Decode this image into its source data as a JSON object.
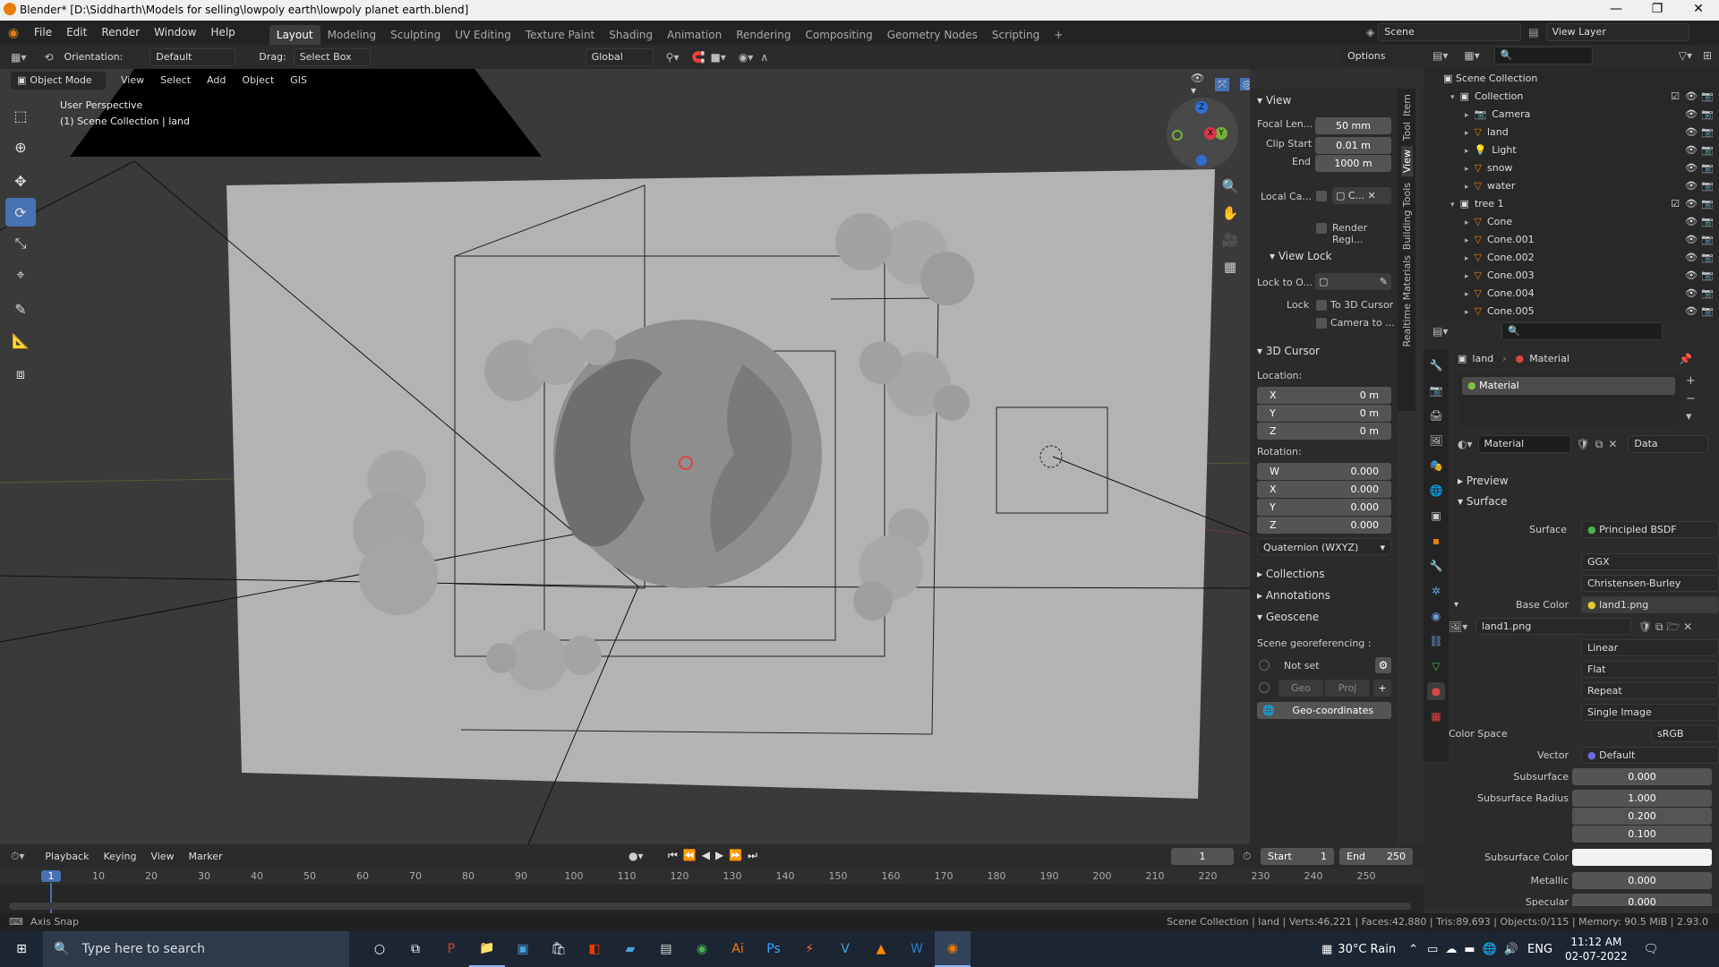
{
  "window": {
    "title": "Blender* [D:\\Siddharth\\Models for selling\\lowpoly earth\\lowpoly planet earth.blend]",
    "min": "—",
    "max": "❐",
    "close": "✕"
  },
  "menu": [
    "File",
    "Edit",
    "Render",
    "Window",
    "Help"
  ],
  "workspaces": [
    "Layout",
    "Modeling",
    "Sculpting",
    "UV Editing",
    "Texture Paint",
    "Shading",
    "Animation",
    "Rendering",
    "Compositing",
    "Geometry Nodes",
    "Scripting",
    "+"
  ],
  "scene": {
    "label": "Scene",
    "view_layer": "View Layer"
  },
  "header3d": {
    "orientation_label": "Orientation:",
    "orientation_value": "Default",
    "drag_label": "Drag:",
    "drag_value": "Select Box",
    "transform": "Global",
    "options": "Options"
  },
  "header3d2": {
    "mode": "Object Mode",
    "items": [
      "View",
      "Select",
      "Add",
      "Object",
      "GIS"
    ]
  },
  "viewport": {
    "perspective": "User Perspective",
    "collection": "(1) Scene Collection | land"
  },
  "gizmo": {
    "z": "Z",
    "y": "Y",
    "x": "X"
  },
  "npanel": {
    "view_title": "View",
    "focal_label": "Focal Len...",
    "focal_value": "50 mm",
    "clip_start_label": "Clip Start",
    "clip_start_value": "0.01 m",
    "end_label": "End",
    "end_value": "1000 m",
    "local_cam_label": "Local Ca...",
    "local_cam_value": "C...",
    "render_region": "Render Regi...",
    "view_lock_title": "View Lock",
    "lock_obj_label": "Lock to O...",
    "lock_label": "Lock",
    "to_cursor": "To 3D Cursor",
    "camera_to": "Camera to ...",
    "cursor_title": "3D Cursor",
    "location_label": "Location:",
    "loc": [
      {
        "axis": "X",
        "value": "0 m"
      },
      {
        "axis": "Y",
        "value": "0 m"
      },
      {
        "axis": "Z",
        "value": "0 m"
      }
    ],
    "rotation_label": "Rotation:",
    "rot": [
      {
        "axis": "W",
        "value": "0.000"
      },
      {
        "axis": "X",
        "value": "0.000"
      },
      {
        "axis": "Y",
        "value": "0.000"
      },
      {
        "axis": "Z",
        "value": "0.000"
      }
    ],
    "rot_mode": "Quaternion (WXYZ)",
    "collections": "Collections",
    "annotations": "Annotations",
    "geoscene": "Geoscene",
    "georef_label": "Scene georeferencing :",
    "not_set": "Not set",
    "geo": "Geo",
    "proj": "Proj",
    "geo_coords": "Geo-coordinates"
  },
  "vtabs": [
    "Item",
    "Tool",
    "View",
    "Building Tools",
    "Realtime Materials"
  ],
  "outliner": {
    "scene_collection": "Scene Collection",
    "rows": [
      {
        "name": "Collection",
        "indent": 1,
        "icon": "collection"
      },
      {
        "name": "Camera",
        "indent": 2,
        "icon": "camera"
      },
      {
        "name": "land",
        "indent": 2,
        "icon": "mesh"
      },
      {
        "name": "Light",
        "indent": 2,
        "icon": "light"
      },
      {
        "name": "snow",
        "indent": 2,
        "icon": "mesh"
      },
      {
        "name": "water",
        "indent": 2,
        "icon": "mesh"
      },
      {
        "name": "tree 1",
        "indent": 1,
        "icon": "collection"
      },
      {
        "name": "Cone",
        "indent": 2,
        "icon": "mesh"
      },
      {
        "name": "Cone.001",
        "indent": 2,
        "icon": "mesh"
      },
      {
        "name": "Cone.002",
        "indent": 2,
        "icon": "mesh"
      },
      {
        "name": "Cone.003",
        "indent": 2,
        "icon": "mesh"
      },
      {
        "name": "Cone.004",
        "indent": 2,
        "icon": "mesh"
      },
      {
        "name": "Cone.005",
        "indent": 2,
        "icon": "mesh"
      }
    ]
  },
  "props": {
    "breadcrumb_obj": "land",
    "breadcrumb_mat": "Material",
    "slot": "Material",
    "mat_name": "Material",
    "link": "Data",
    "preview": "Preview",
    "surface_title": "Surface",
    "surface_label": "Surface",
    "surface_value": "Principled BSDF",
    "distribution": "GGX",
    "subsurface_method": "Christensen-Burley",
    "base_color_label": "Base Color",
    "base_color_value": "land1.png",
    "image_name": "land1.png",
    "interp": "Linear",
    "projection": "Flat",
    "extension": "Repeat",
    "source": "Single Image",
    "color_space_label": "Color Space",
    "color_space_value": "sRGB",
    "vector_label": "Vector",
    "vector_value": "Default",
    "subsurface_label": "Subsurface",
    "subsurface_value": "0.000",
    "ss_radius_label": "Subsurface Radius",
    "ss_radius": [
      "1.000",
      "0.200",
      "0.100"
    ],
    "ss_color_label": "Subsurface Color",
    "metallic_label": "Metallic",
    "metallic_value": "0.000",
    "specular_label": "Specular",
    "specular_value": "0.000"
  },
  "timeline": {
    "items": [
      "Playback",
      "Keying",
      "View",
      "Marker"
    ],
    "current_frame": "1",
    "start_label": "Start",
    "start_value": "1",
    "end_label": "End",
    "end_value": "250",
    "ticks": [
      "1",
      "10",
      "20",
      "30",
      "40",
      "50",
      "60",
      "70",
      "80",
      "90",
      "100",
      "110",
      "120",
      "130",
      "140",
      "150",
      "160",
      "170",
      "180",
      "190",
      "200",
      "210",
      "220",
      "230",
      "240",
      "250"
    ]
  },
  "status": {
    "left": "Axis Snap",
    "right": "Scene Collection | land | Verts:46,221 | Faces:42,880 | Tris:89,693 | Objects:0/115 | Memory: 90.5 MiB | 2.93.0"
  },
  "taskbar": {
    "search_placeholder": "Type here to search",
    "weather": "30°C  Rain",
    "lang": "ENG",
    "time": "11:12 AM",
    "date": "02-07-2022"
  },
  "colors": {
    "accent": "#4772b3",
    "orange": "#e87d0d"
  }
}
